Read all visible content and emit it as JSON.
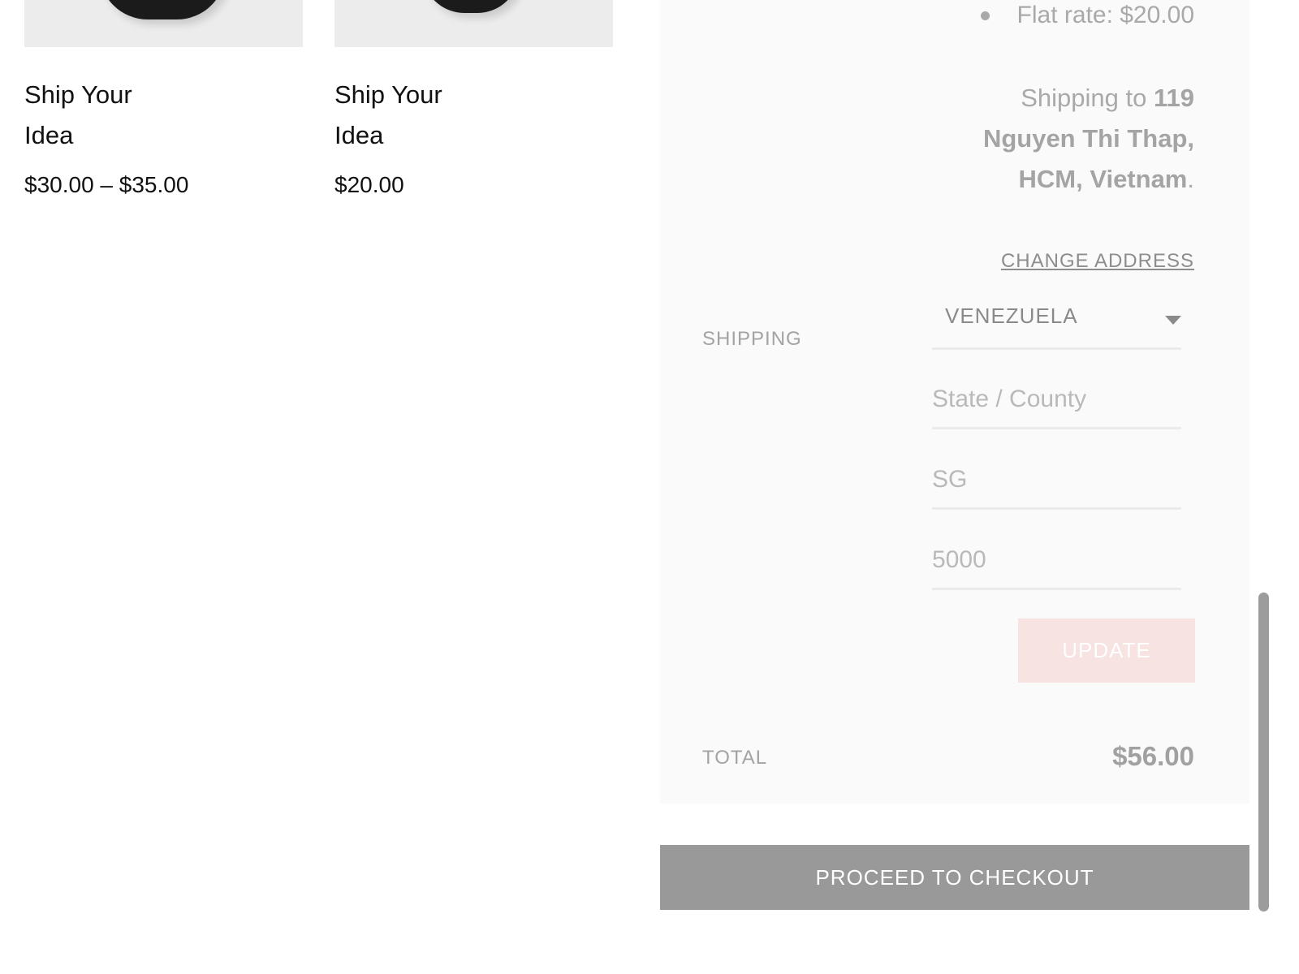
{
  "products": [
    {
      "title_line1": "Ship Your",
      "title_line2": "Idea",
      "price": "$30.00 – $35.00",
      "image": "hoodie-image"
    },
    {
      "title_line1": "Ship Your",
      "title_line2": "Idea",
      "price": "$20.00",
      "image": "tshirt-image"
    }
  ],
  "cart_totals": {
    "flat_rate": "Flat rate: $20.00",
    "shipping_to_prefix": "Shipping to ",
    "shipping_address_line1": "119",
    "shipping_address_line2": "Nguyen Thi Thap,",
    "shipping_address_line3": "HCM, Vietnam",
    "shipping_to_suffix": ".",
    "change_address": "CHANGE ADDRESS",
    "shipping_label": "SHIPPING",
    "country": "VENEZUELA",
    "state_placeholder": "State / County",
    "city_value": "SG",
    "postcode_value": "5000",
    "update_label": "UPDATE",
    "total_label": "TOTAL",
    "total_value": "$56.00"
  },
  "checkout_label": "PROCEED TO CHECKOUT",
  "colors": {
    "panel_bg": "#fafafa",
    "update_button_bg": "#f7e3e1",
    "checkout_button_bg": "#999999"
  }
}
